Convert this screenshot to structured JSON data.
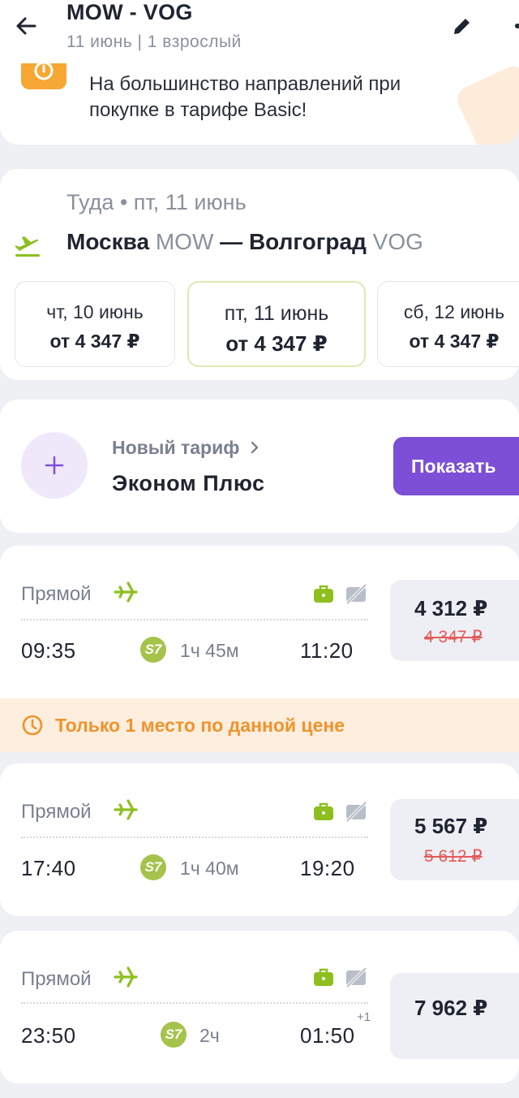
{
  "header": {
    "title": "MOW - VOG",
    "subtitle": "11 июнь | 1 взрослый"
  },
  "promo": {
    "text": "На большинство направлений при покупке в тарифе Basic!"
  },
  "route": {
    "direction_date": "Туда • пт, 11 июнь",
    "from_city": "Москва",
    "from_code": "MOW",
    "separator": "—",
    "to_city": "Волгоград",
    "to_code": "VOG",
    "dates": [
      {
        "date": "чт, 10 июнь",
        "price": "от 4 347 ₽",
        "selected": false
      },
      {
        "date": "пт, 11 июнь",
        "price": "от 4 347 ₽",
        "selected": true
      },
      {
        "date": "сб, 12 июнь",
        "price": "от 4 347 ₽",
        "selected": false
      }
    ]
  },
  "tariff": {
    "label": "Новый тариф",
    "name": "Эконом Плюс",
    "button": "Показать"
  },
  "flights": [
    {
      "type": "Прямой",
      "depart": "09:35",
      "airline": "S7",
      "duration": "1ч 45м",
      "arrive": "11:20",
      "day_offset": "",
      "price": "4 312 ₽",
      "old_price": "4 347 ₽"
    },
    {
      "type": "Прямой",
      "depart": "17:40",
      "airline": "S7",
      "duration": "1ч 40м",
      "arrive": "19:20",
      "day_offset": "",
      "price": "5 567 ₽",
      "old_price": "5 612 ₽"
    },
    {
      "type": "Прямой",
      "depart": "23:50",
      "airline": "S7",
      "duration": "2ч",
      "arrive": "01:50",
      "day_offset": "+1",
      "price": "7 962 ₽",
      "old_price": ""
    }
  ],
  "warning": {
    "text": "Только 1 место по данной цене"
  },
  "colors": {
    "accent_green": "#8dbf1f",
    "accent_purple": "#7c4fd6",
    "warning_orange": "#f0932b",
    "old_price_red": "#e25b5b"
  }
}
